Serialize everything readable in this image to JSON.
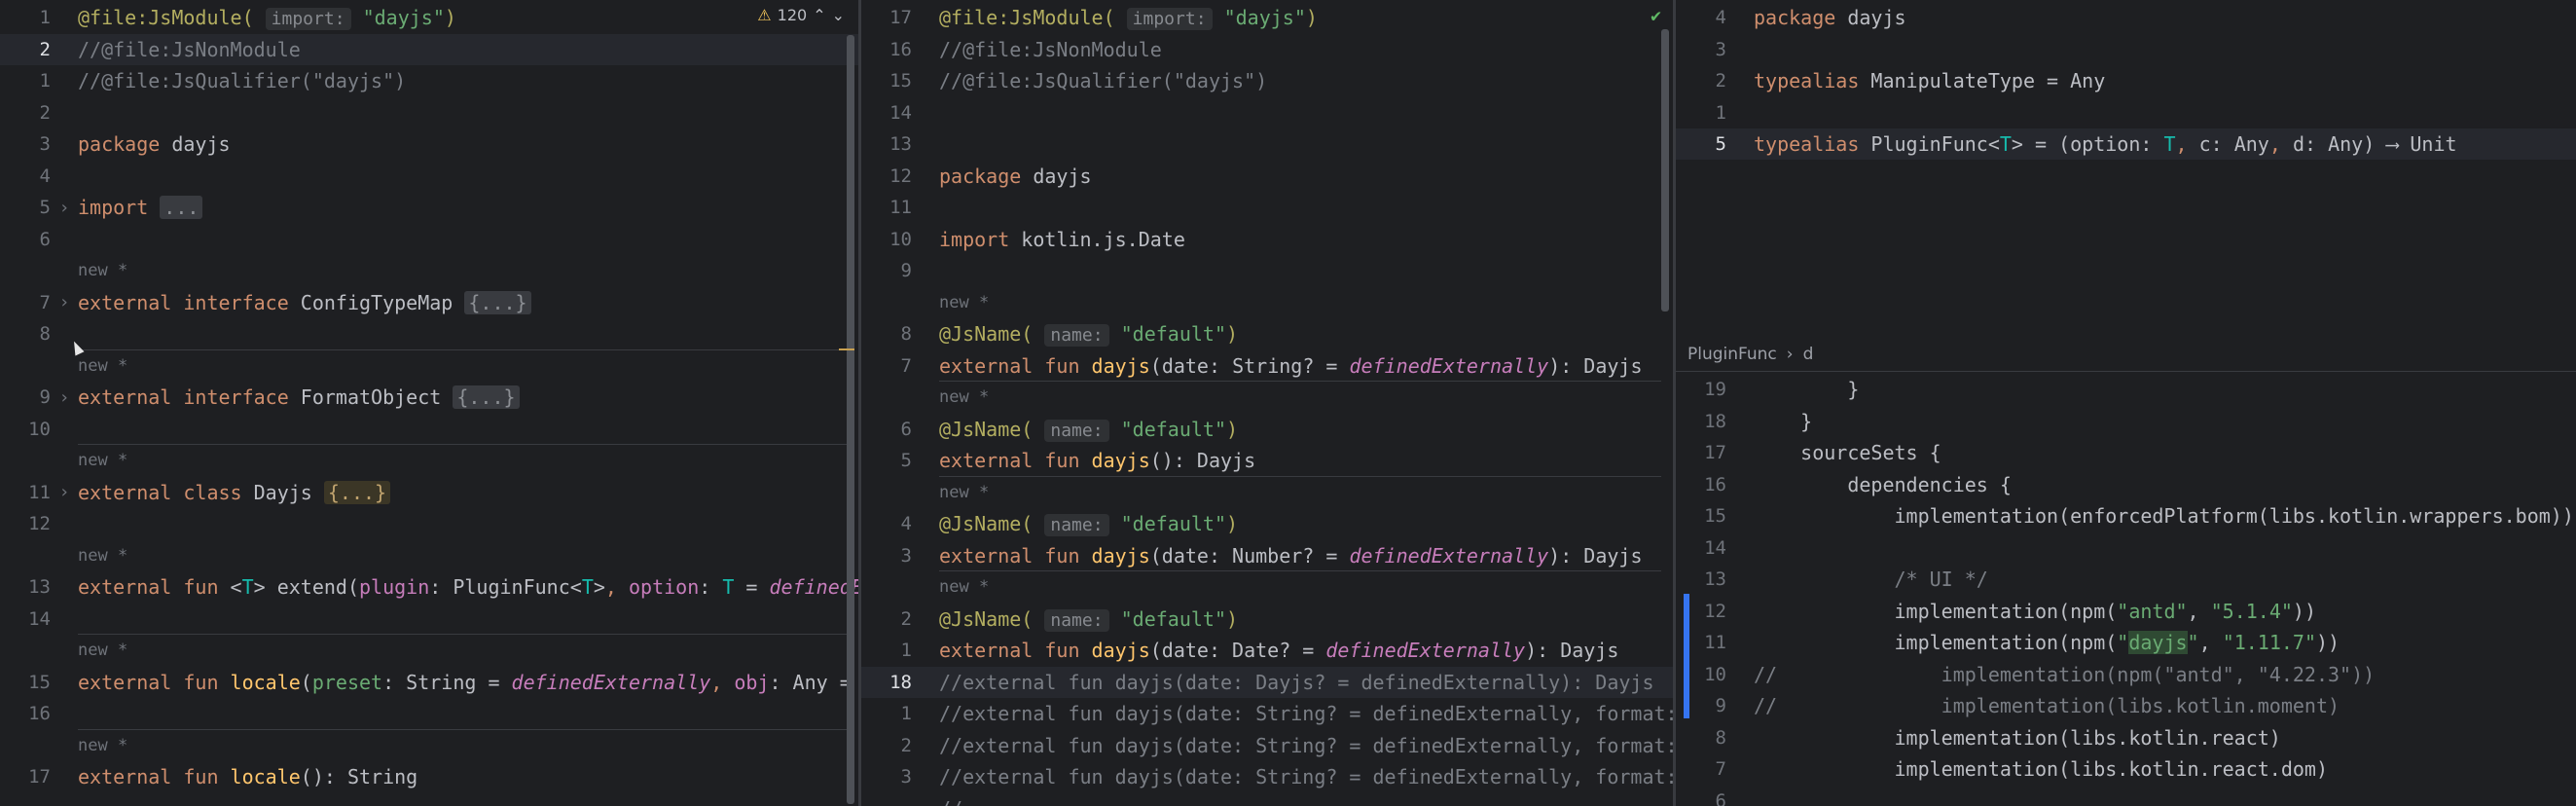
{
  "pane1": {
    "warning_count": "120",
    "lines": [
      {
        "n": "1",
        "html": "<span class=\"a\">@file:JsModule(</span> <span class=\"inl\">import:</span> <span class=\"s\">\"dayjs\"</span><span class=\"a\">)</span>"
      },
      {
        "n": "2",
        "html": "<span class=\"cm\">//@file:JsNonModule</span>",
        "cur": true
      },
      {
        "n": "1",
        "html": "<span class=\"cm\">//@file:JsQualifier(\"dayjs\")</span>"
      },
      {
        "n": "2",
        "html": ""
      },
      {
        "n": "3",
        "html": "<span class=\"k\">package</span> dayjs"
      },
      {
        "n": "4",
        "html": ""
      },
      {
        "n": "5",
        "fold": true,
        "html": "<span class=\"k\">import</span> <span class=\"fld\">...</span>"
      },
      {
        "n": "6",
        "html": ""
      },
      {
        "n": "",
        "hint": "new *"
      },
      {
        "n": "7",
        "fold": true,
        "html": "<span class=\"k\">external interface</span> ConfigTypeMap <span class=\"fld\">{...}</span>"
      },
      {
        "n": "8",
        "html": ""
      },
      {
        "sep": true,
        "n": "",
        "hint": "new *"
      },
      {
        "n": "9",
        "fold": true,
        "html": "<span class=\"k\">external interface</span> FormatObject <span class=\"fld\">{...}</span>"
      },
      {
        "n": "10",
        "html": ""
      },
      {
        "sep": true,
        "n": "",
        "hint": "new *"
      },
      {
        "n": "11",
        "fold": true,
        "html": "<span class=\"k\">external class</span> Dayjs <span class=\"fldy\">{...}</span>"
      },
      {
        "n": "12",
        "html": ""
      },
      {
        "n": "",
        "hint": "new *"
      },
      {
        "n": "13",
        "html": "<span class=\"k\">external fun</span> &lt;<span class=\"t\">T</span>&gt; extend(<span class=\"p\">plugin</span>: PluginFunc&lt;<span class=\"t\">T</span>&gt;<span class=\"k\">,</span> <span class=\"p\">option</span>: <span class=\"t\">T</span> = <span class=\"it\">definedExternally</span>)"
      },
      {
        "n": "14",
        "html": ""
      },
      {
        "sep": true,
        "n": "",
        "hint": "new *"
      },
      {
        "n": "15",
        "html": "<span class=\"k\">external fun</span> <span class=\"fy\">locale</span>(<span class=\"s\">preset</span>: String = <span class=\"it\">definedExternally</span><span class=\"k\">,</span> <span class=\"p\">obj</span>: Any = <span class=\"it\">definedExternally</span>)"
      },
      {
        "n": "16",
        "html": ""
      },
      {
        "sep": true,
        "n": "",
        "hint": "new *"
      },
      {
        "n": "17",
        "html": "<span class=\"k\">external fun</span> <span class=\"fy\">locale</span>(): String"
      }
    ]
  },
  "pane2": {
    "lines": [
      {
        "n": "17",
        "html": "<span class=\"a\">@file:JsModule(</span> <span class=\"inl\">import:</span> <span class=\"s\">\"dayjs\"</span><span class=\"a\">)</span>"
      },
      {
        "n": "16",
        "html": "<span class=\"cm\">//@file:JsNonModule</span>"
      },
      {
        "n": "15",
        "html": "<span class=\"cm\">//@file:JsQualifier(\"dayjs\")</span>"
      },
      {
        "n": "14",
        "html": ""
      },
      {
        "n": "13",
        "html": ""
      },
      {
        "n": "12",
        "html": "<span class=\"k\">package</span> dayjs"
      },
      {
        "n": "11",
        "html": ""
      },
      {
        "n": "10",
        "html": "<span class=\"k\">import</span> kotlin.js.Date"
      },
      {
        "n": "9",
        "html": ""
      },
      {
        "n": "",
        "hint": "new *"
      },
      {
        "n": "8",
        "html": "<span class=\"a\">@JsName(</span> <span class=\"inl\">name:</span> <span class=\"s\">\"default\"</span><span class=\"a\">)</span>"
      },
      {
        "n": "7",
        "html": "<span class=\"k\">external fun</span> <span class=\"fy\">dayjs</span>(<span class=\"ty\">date</span>: String? = <span class=\"it\">definedExternally</span>): Dayjs"
      },
      {
        "sep": true,
        "n": "",
        "hint": "new *"
      },
      {
        "n": "6",
        "html": "<span class=\"a\">@JsName(</span> <span class=\"inl\">name:</span> <span class=\"s\">\"default\"</span><span class=\"a\">)</span>"
      },
      {
        "n": "5",
        "html": "<span class=\"k\">external fun</span> <span class=\"fy\">dayjs</span>(): Dayjs"
      },
      {
        "sep": true,
        "n": "",
        "hint": "new *"
      },
      {
        "n": "4",
        "html": "<span class=\"a\">@JsName(</span> <span class=\"inl\">name:</span> <span class=\"s\">\"default\"</span><span class=\"a\">)</span>"
      },
      {
        "n": "3",
        "html": "<span class=\"k\">external fun</span> <span class=\"fy\">dayjs</span>(date: Number? = <span class=\"it\">definedExternally</span>): Dayjs"
      },
      {
        "sep": true,
        "n": "",
        "hint": "new *"
      },
      {
        "n": "2",
        "html": "<span class=\"a\">@JsName(</span> <span class=\"inl\">name:</span> <span class=\"s\">\"default\"</span><span class=\"a\">)</span>"
      },
      {
        "n": "1",
        "html": "<span class=\"k\">external fun</span> <span class=\"fy\">dayjs</span>(date: Date? = <span class=\"it\">definedExternally</span>): Dayjs"
      },
      {
        "n": "18",
        "cur": true,
        "html": "<span class=\"cm\">//external fun dayjs(date: Dayjs? = definedExternally): Dayjs</span>"
      },
      {
        "n": "1",
        "html": "<span class=\"cm\">//external fun dayjs(date: String? = definedExternally, format: Format</span>"
      },
      {
        "n": "2",
        "html": "<span class=\"cm\">//external fun dayjs(date: String? = definedExternally, format: Format</span>"
      },
      {
        "n": "3",
        "html": "<span class=\"cm\">//external fun dayjs(date: String? = definedExternally, format: Strin</span>"
      },
      {
        "n": "",
        "html": "<span class=\"cm\">//</span>"
      }
    ]
  },
  "pane3": {
    "lines": [
      {
        "n": "4",
        "html": "<span class=\"k\">package</span> dayjs"
      },
      {
        "n": "3",
        "html": ""
      },
      {
        "n": "2",
        "html": "<span class=\"k\">typealias</span> ManipulateType = Any"
      },
      {
        "n": "1",
        "html": ""
      },
      {
        "n": "5",
        "cur": true,
        "html": "<span class=\"k\">typealias</span> PluginFunc&lt;<span class=\"t\">T</span>&gt; = (option: <span class=\"t\">T</span><span class=\"k\">,</span> c: Any<span class=\"k\">,</span> d: Any) ⟶ Unit"
      }
    ]
  },
  "pane4": {
    "breadcrumb": [
      "PluginFunc",
      "d"
    ],
    "lines": [
      {
        "n": "19",
        "html": "        }"
      },
      {
        "n": "18",
        "html": "    }"
      },
      {
        "n": "17",
        "html": "    sourceSets {"
      },
      {
        "n": "16",
        "html": "        dependencies {"
      },
      {
        "n": "15",
        "html": "            implementation(enforcedPlatform(libs.kotlin.wrappers.bom))"
      },
      {
        "n": "14",
        "html": ""
      },
      {
        "n": "13",
        "html": "            <span class=\"cm\">/* UI */</span>"
      },
      {
        "n": "12",
        "html": "            implementation(npm(<span class=\"s\">\"antd\"</span>, <span class=\"s\">\"5.1.4\"</span>))"
      },
      {
        "n": "11",
        "html": "            implementation(npm(<span class=\"s\">\"<span class=\"hl\">dayjs</span>\"</span>, <span class=\"s\">\"1.11.7\"</span>))"
      },
      {
        "n": "10",
        "html": "<span class=\"cm\">//              implementation(npm(\"antd\", \"4.22.3\"))</span>"
      },
      {
        "n": "9",
        "html": "<span class=\"cm\">//              implementation(libs.kotlin.moment)</span>"
      },
      {
        "n": "8",
        "html": "            implementation(libs.kotlin.react)"
      },
      {
        "n": "7",
        "html": "            implementation(libs.kotlin.react.dom)"
      },
      {
        "n": "6",
        "html": ""
      }
    ]
  },
  "colors": {
    "accent": "#3574f0",
    "keyword": "#cf8e6d",
    "string": "#6aab73",
    "annotation": "#b3ae60"
  }
}
